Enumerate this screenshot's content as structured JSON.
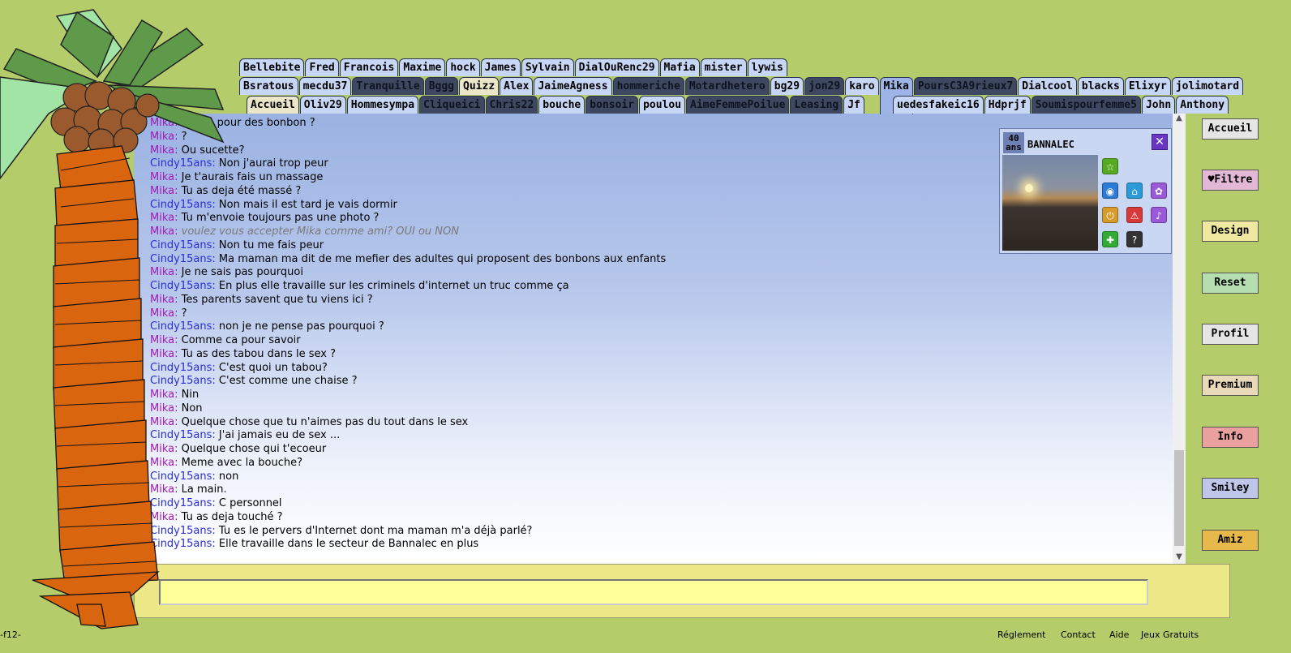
{
  "tabs": {
    "row1": [
      {
        "label": "Bellebite",
        "style": "light"
      },
      {
        "label": "Fred",
        "style": "light"
      },
      {
        "label": "Francois",
        "style": "light"
      },
      {
        "label": "Maxime",
        "style": "light"
      },
      {
        "label": "hock",
        "style": "light"
      },
      {
        "label": "James",
        "style": "light"
      },
      {
        "label": "Sylvain",
        "style": "light"
      },
      {
        "label": "DialOuRenc29",
        "style": "light"
      },
      {
        "label": "Mafia",
        "style": "light"
      },
      {
        "label": "mister",
        "style": "light"
      },
      {
        "label": "lywis",
        "style": "light"
      }
    ],
    "row2": [
      {
        "label": "Bsratous",
        "style": "light"
      },
      {
        "label": "mecdu37",
        "style": "light"
      },
      {
        "label": "Tranquille",
        "style": "dark"
      },
      {
        "label": "Bggg",
        "style": "dark"
      },
      {
        "label": "Quizz",
        "style": "cream"
      },
      {
        "label": "Alex",
        "style": "light"
      },
      {
        "label": "JaimeAgness",
        "style": "light"
      },
      {
        "label": "hommeriche",
        "style": "dark"
      },
      {
        "label": "Motardhetero",
        "style": "dark"
      },
      {
        "label": "bg29",
        "style": "light"
      },
      {
        "label": "jon29",
        "style": "dark"
      },
      {
        "label": "karo",
        "style": "light"
      },
      {
        "label": "Mika",
        "style": "sel"
      },
      {
        "label": "PoursC3A9rieux7",
        "style": "dark"
      },
      {
        "label": "Dialcool",
        "style": "light"
      },
      {
        "label": "blacks",
        "style": "light"
      },
      {
        "label": "Elixyr",
        "style": "light"
      },
      {
        "label": "jolimotard",
        "style": "light"
      }
    ],
    "row3a": [
      {
        "label": "Accueil",
        "style": "cream"
      },
      {
        "label": "Oliv29",
        "style": "light"
      },
      {
        "label": "Hommesympa",
        "style": "light"
      },
      {
        "label": "Cliqueici",
        "style": "dark"
      },
      {
        "label": "Chris22",
        "style": "dark"
      },
      {
        "label": "bouche",
        "style": "light"
      },
      {
        "label": "bonsoir",
        "style": "dark"
      },
      {
        "label": "poulou",
        "style": "light"
      },
      {
        "label": "AimeFemmePoilue",
        "style": "dark"
      },
      {
        "label": "Leasing",
        "style": "dark"
      },
      {
        "label": "Jf",
        "style": "light"
      }
    ],
    "row3b": [
      {
        "label": "uedesfakeic16",
        "style": "light"
      },
      {
        "label": "Hdprjf",
        "style": "light"
      },
      {
        "label": "Soumispourfemme5",
        "style": "dark"
      },
      {
        "label": "John",
        "style": "light"
      },
      {
        "label": "Anthony",
        "style": "light"
      }
    ]
  },
  "messages": [
    {
      "from": "Mika",
      "text": "Meme pour des bonbon ?",
      "type": "mika"
    },
    {
      "from": "Mika",
      "text": "?",
      "type": "mika"
    },
    {
      "from": "Mika",
      "text": "Ou sucette?",
      "type": "mika"
    },
    {
      "from": "Cindy15ans",
      "text": "Non j'aurai trop peur",
      "type": "cindy"
    },
    {
      "from": "Mika",
      "text": "Je t'aurais fais un massage",
      "type": "mika"
    },
    {
      "from": "Mika",
      "text": "Tu as deja été massé ?",
      "type": "mika"
    },
    {
      "from": "Cindy15ans",
      "text": "Non mais il est tard je vais dormir",
      "type": "cindy"
    },
    {
      "from": "Mika",
      "text": "Tu m'envoie toujours pas une photo ?",
      "type": "mika"
    },
    {
      "from": "Mika",
      "text": "voulez vous accepter Mika comme ami? OUI ou NON",
      "type": "sys"
    },
    {
      "from": "Cindy15ans",
      "text": "Non tu me fais peur",
      "type": "cindy"
    },
    {
      "from": "Cindy15ans",
      "text": "Ma maman ma dit de me mefier des adultes qui proposent des bonbons aux enfants",
      "type": "cindy"
    },
    {
      "from": "Mika",
      "text": "Je ne sais pas pourquoi",
      "type": "mika"
    },
    {
      "from": "Cindy15ans",
      "text": "En plus elle travaille sur les criminels d'internet un truc comme ça",
      "type": "cindy"
    },
    {
      "from": "Mika",
      "text": "Tes parents savent que tu viens ici ?",
      "type": "mika"
    },
    {
      "from": "Mika",
      "text": "?",
      "type": "mika"
    },
    {
      "from": "Cindy15ans",
      "text": "non je ne pense pas pourquoi ?",
      "type": "cindy"
    },
    {
      "from": "Mika",
      "text": "Comme ca pour savoir",
      "type": "mika"
    },
    {
      "from": "Mika",
      "text": "Tu as des tabou dans le sex ?",
      "type": "mika"
    },
    {
      "from": "Cindy15ans",
      "text": "C'est quoi un tabou?",
      "type": "cindy"
    },
    {
      "from": "Cindy15ans",
      "text": "C'est comme une chaise ?",
      "type": "cindy"
    },
    {
      "from": "Mika",
      "text": "Nin",
      "type": "mika"
    },
    {
      "from": "Mika",
      "text": "Non",
      "type": "mika"
    },
    {
      "from": "Mika",
      "text": "Quelque chose que tu n'aimes pas du tout dans le sex",
      "type": "mika"
    },
    {
      "from": "Cindy15ans",
      "text": "J'ai jamais eu de sex ...",
      "type": "cindy"
    },
    {
      "from": "Mika",
      "text": "Quelque chose qui t'ecoeur",
      "type": "mika"
    },
    {
      "from": "Mika",
      "text": "Meme avec la bouche?",
      "type": "mika"
    },
    {
      "from": "Cindy15ans",
      "text": "non",
      "type": "cindy"
    },
    {
      "from": "Mika",
      "text": "La main.",
      "type": "mika"
    },
    {
      "from": "Cindy15ans",
      "text": "C personnel",
      "type": "cindy"
    },
    {
      "from": "Mika",
      "text": "Tu as deja touché ?",
      "type": "mika"
    },
    {
      "from": "Cindy15ans",
      "text": "Tu es le pervers d'Internet dont ma maman m'a déjà parlé?",
      "type": "cindy"
    },
    {
      "from": "Cindy15ans",
      "text": "Elle travaille dans le secteur de Bannalec en plus",
      "type": "cindy"
    }
  ],
  "profile": {
    "age_number": "40",
    "age_unit": "ans",
    "city": "BANNALEC",
    "close": "✕"
  },
  "profile_icons": [
    {
      "name": "star-icon",
      "glyph": "☆",
      "color": "#55aa22"
    },
    {
      "name": "webcam-icon",
      "glyph": "◉",
      "color": "#2a7ad8"
    },
    {
      "name": "car-icon",
      "glyph": "⌂",
      "color": "#2a9ad8"
    },
    {
      "name": "flower-icon",
      "glyph": "✿",
      "color": "#9a5ad8"
    },
    {
      "name": "power-icon",
      "glyph": "⏻",
      "color": "#d89a2a"
    },
    {
      "name": "warning-icon",
      "glyph": "⚠",
      "color": "#d83a3a"
    },
    {
      "name": "microphone-icon",
      "glyph": "♪",
      "color": "#9a5ad8"
    },
    {
      "name": "plus-icon",
      "glyph": "✚",
      "color": "#33aa33"
    },
    {
      "name": "help-icon",
      "glyph": "?",
      "color": "#333333"
    }
  ],
  "right_menu": [
    {
      "label": "Accueil",
      "bg": "#e5e5e5"
    },
    {
      "label": "♥Filtre",
      "bg": "#e2b8d6"
    },
    {
      "label": "Design",
      "bg": "#eee8a0"
    },
    {
      "label": "Reset",
      "bg": "#b4ddb0"
    },
    {
      "label": "Profil",
      "bg": "#e5e5e5"
    },
    {
      "label": "Premium",
      "bg": "#ead9b8"
    },
    {
      "label": "Info",
      "bg": "#eba0a0"
    },
    {
      "label": "Smiley",
      "bg": "#c0c6ea"
    },
    {
      "label": "Amiz",
      "bg": "#e7b84a"
    }
  ],
  "input": {
    "placeholder": ""
  },
  "footer": {
    "left": "-f12-",
    "links": [
      "Réglement",
      "Contact",
      "Aide",
      "Jeux Gratuits"
    ]
  }
}
